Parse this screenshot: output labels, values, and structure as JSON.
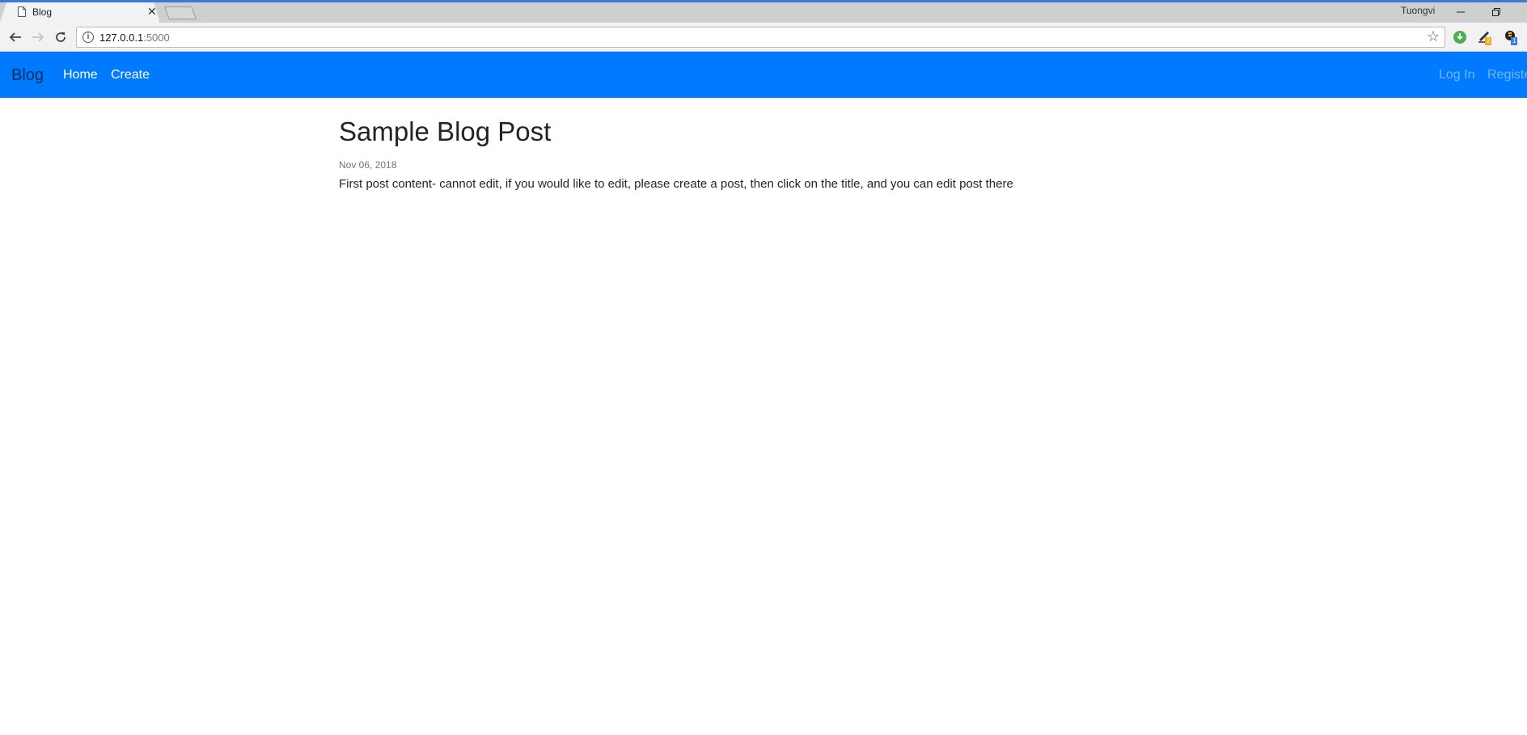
{
  "browser": {
    "tab_title": "Blog",
    "tab_close": "✕",
    "profile_name": "Tuongvi",
    "url_host": "127.0.0.1",
    "url_port": ":5000",
    "ext_badges": [
      "2",
      "1"
    ],
    "accent_color": "#3a7bd5"
  },
  "navbar": {
    "brand": "Blog",
    "links": [
      "Home",
      "Create"
    ],
    "right_links": [
      "Log In",
      "Register"
    ],
    "background": "#007bff"
  },
  "post": {
    "title": "Sample Blog Post",
    "date": "Nov 06, 2018",
    "content": "First post content- cannot edit, if you would like to edit, please create a post, then click on the title, and you can edit post there"
  }
}
